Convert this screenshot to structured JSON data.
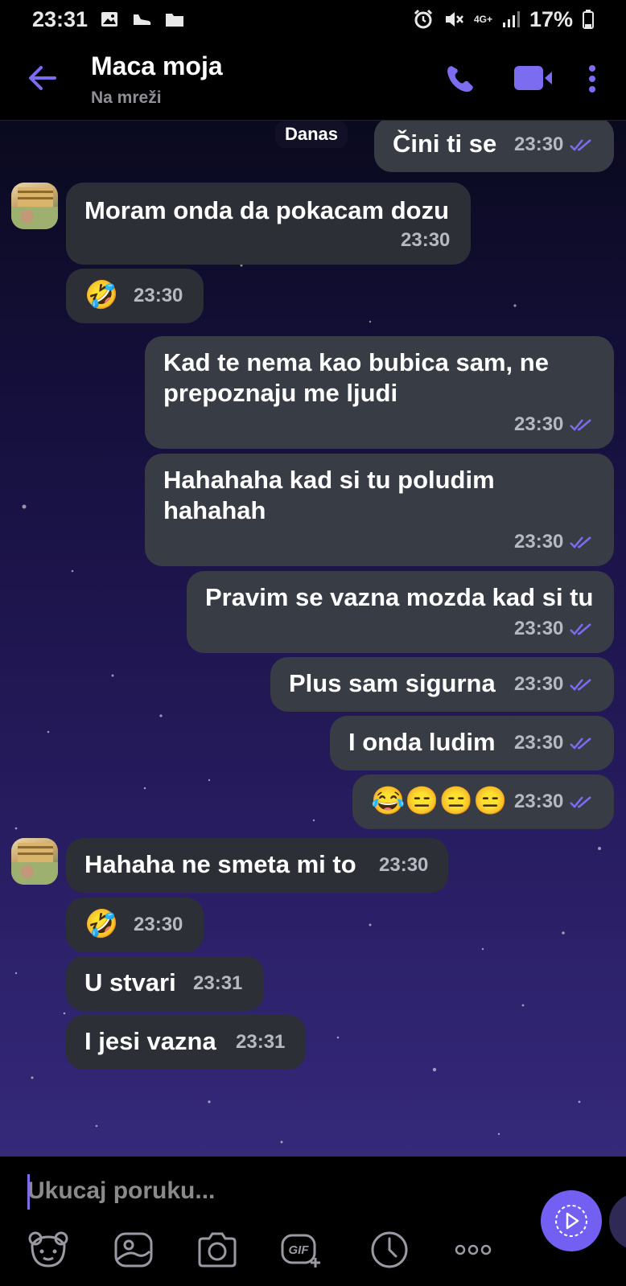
{
  "status_bar": {
    "time": "23:31",
    "network": "4G+",
    "battery": "17%"
  },
  "header": {
    "contact_name": "Maca moja",
    "presence": "Na mreži"
  },
  "chat": {
    "date_label": "Danas",
    "messages": [
      {
        "dir": "out",
        "text": "Čini ti se",
        "time": "23:30"
      },
      {
        "dir": "in",
        "text": "Moram onda da pokacam dozu",
        "time": "23:30"
      },
      {
        "dir": "in",
        "text": "🤣",
        "time": "23:30"
      },
      {
        "dir": "out",
        "text": "Kad te nema kao bubica sam, ne",
        "text2": "prepoznaju me ljudi",
        "time": "23:30"
      },
      {
        "dir": "out",
        "text": "Hahahaha kad si tu poludim",
        "text2": "hahahah",
        "time": "23:30"
      },
      {
        "dir": "out",
        "text": "Pravim se vazna mozda kad si tu",
        "time": "23:30"
      },
      {
        "dir": "out",
        "text": "Plus sam sigurna",
        "time": "23:30"
      },
      {
        "dir": "out",
        "text": "I onda ludim",
        "time": "23:30"
      },
      {
        "dir": "out",
        "text": "😂😑😑😑",
        "time": "23:30"
      },
      {
        "dir": "in",
        "text": "Hahaha ne smeta mi to",
        "time": "23:30"
      },
      {
        "dir": "in",
        "text": "🤣",
        "time": "23:30"
      },
      {
        "dir": "in",
        "text": "U stvari",
        "time": "23:31"
      },
      {
        "dir": "in",
        "text": "I jesi vazna",
        "time": "23:31"
      }
    ]
  },
  "composer": {
    "placeholder": "Ukucaj poruku...",
    "gif_label": "GIF"
  },
  "colors": {
    "accent": "#7360f2",
    "bubble_in": "#2c2f36",
    "bubble_out": "#383c45"
  },
  "icons": {
    "back": "arrow-left-icon",
    "call": "phone-icon",
    "video": "video-camera-icon",
    "more": "kebab-menu-icon",
    "sticker": "bear-sticker-icon",
    "gallery": "gallery-icon",
    "camera": "camera-icon",
    "gif": "gif-icon",
    "timer": "clock-icon",
    "more_options": "more-dots-icon",
    "send": "play-send-icon"
  }
}
